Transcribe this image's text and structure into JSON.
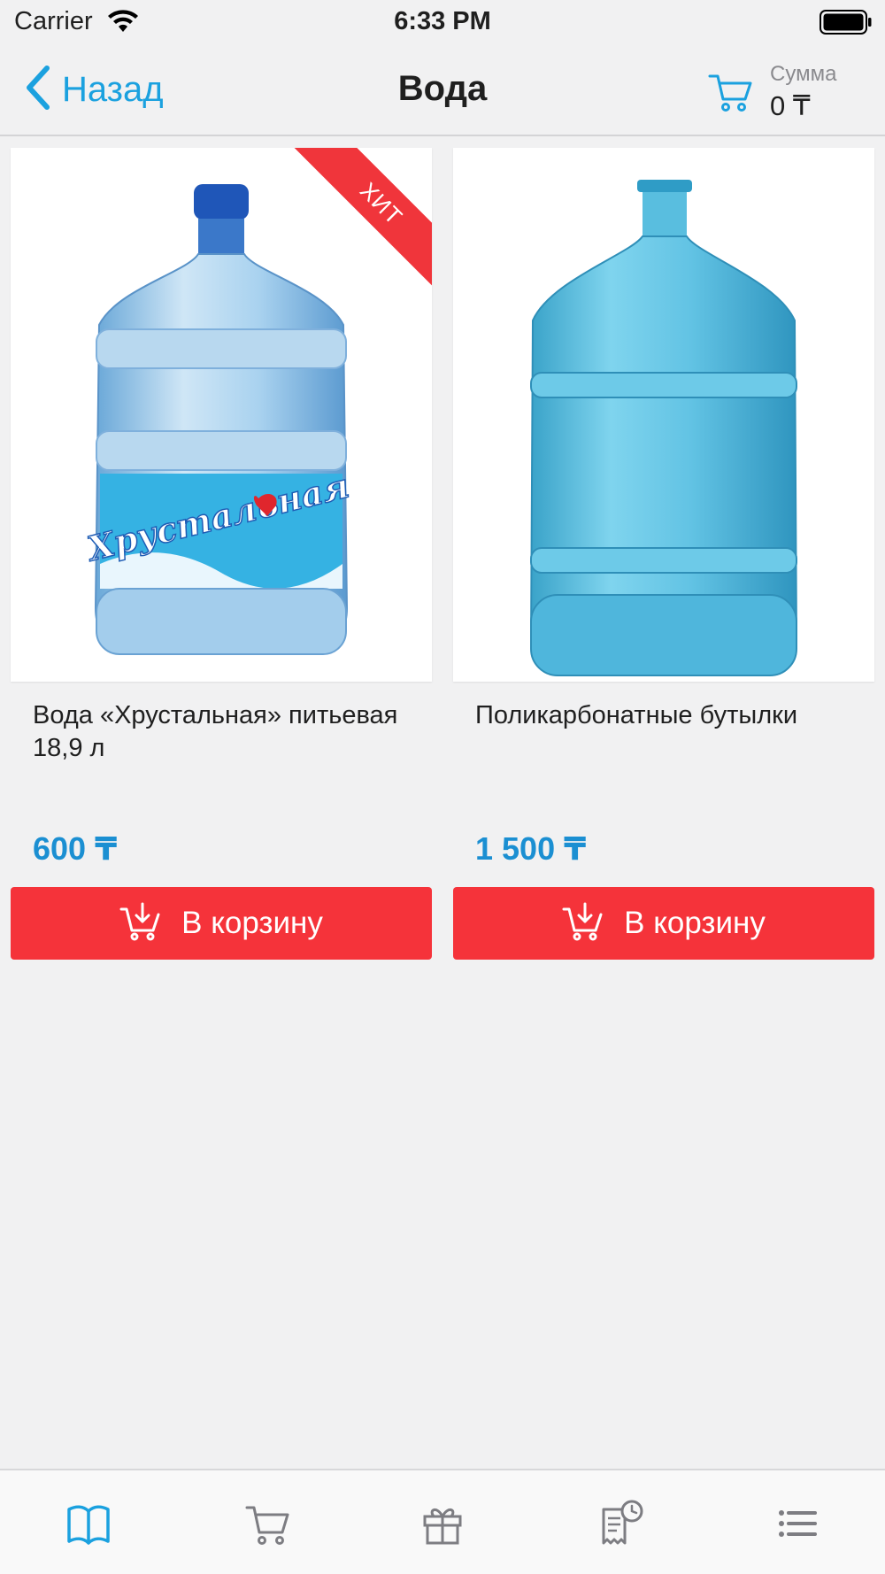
{
  "status_bar": {
    "carrier": "Carrier",
    "time": "6:33 PM"
  },
  "nav": {
    "back_label": "Назад",
    "title": "Вода",
    "cart_sum_label": "Сумма",
    "cart_sum_value": "0 ₸"
  },
  "products": [
    {
      "name": "Вода «Хрустальная» питьевая 18,9 л",
      "price": "600 ₸",
      "badge": "ХИТ",
      "button_label": "В корзину",
      "bottle_label": "Хрустальная"
    },
    {
      "name": "Поликарбонатные бутылки",
      "price": "1 500 ₸",
      "button_label": "В корзину"
    }
  ],
  "tabs": [
    {
      "icon": "catalog-book-icon",
      "active": true
    },
    {
      "icon": "cart-icon",
      "active": false
    },
    {
      "icon": "gift-icon",
      "active": false
    },
    {
      "icon": "order-history-icon",
      "active": false
    },
    {
      "icon": "menu-list-icon",
      "active": false
    }
  ],
  "colors": {
    "accent": "#1ba1df",
    "price": "#1b8fd2",
    "button": "#f5333a",
    "ribbon": "#f0353b",
    "background": "#f1f1f2"
  }
}
